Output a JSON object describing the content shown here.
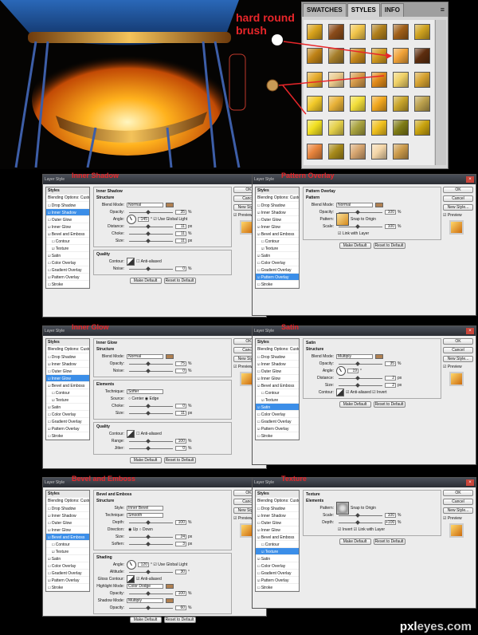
{
  "callout": {
    "line1": "hard round",
    "line2": "brush"
  },
  "panel": {
    "tabs": [
      "SWATCHES",
      "STYLES",
      "INFO"
    ],
    "active": "STYLES",
    "menu": "≡"
  },
  "swatch_colors": [
    "#d8a21c",
    "#8a4b1a",
    "#f0c44a",
    "#b07f1b",
    "#a05f18",
    "#cfa21f",
    "#c08316",
    "#a67e2a",
    "#c9891c",
    "#d39a1e",
    "#f0a238",
    "#5d2d0e",
    "#e6ac2c",
    "#e9c98c",
    "#d59a49",
    "#e18a19",
    "#efd066",
    "#d6a230",
    "#f2c928",
    "#e8b238",
    "#f2de3a",
    "#f1a71e",
    "#c9a52b",
    "#bca14d",
    "#f1df20",
    "#e4d04a",
    "#a8a23f",
    "#f0c01e",
    "#7f7c16",
    "#c9a30f",
    "#e8843c",
    "#a78a1a",
    "#d6a570",
    "#f4d6a8",
    "#cb9a4a"
  ],
  "watermark": {
    "a": "pxl",
    "b": "eyes.com"
  },
  "dialog_title": "Layer Style",
  "common": {
    "styles_header": "Styles",
    "blending": "Blending Options: Custom",
    "ok": "OK",
    "cancel": "Cancel",
    "new_style": "New Style...",
    "preview": "Preview",
    "make_default": "Make Default",
    "reset_default": "Reset to Default"
  },
  "layer_list": [
    "Drop Shadow",
    "Inner Shadow",
    "Outer Glow",
    "Inner Glow",
    "Bevel and Emboss",
    "Contour",
    "Texture",
    "Satin",
    "Color Overlay",
    "Gradient Overlay",
    "Pattern Overlay",
    "Stroke"
  ],
  "dialogs": [
    {
      "name": "Inner Shadow",
      "active": "Inner Shadow",
      "groups": [
        {
          "title": "Inner Shadow",
          "sub": "Structure",
          "rows": [
            [
              "Blend Mode:",
              "Normal",
              "",
              ""
            ],
            [
              "Opacity:",
              "",
              "35",
              "%"
            ],
            [
              "Angle:",
              "",
              "-145",
              "° ☑ Use Global Light"
            ],
            [
              "Distance:",
              "",
              "11",
              "px"
            ],
            [
              "Choke:",
              "",
              "11",
              "%"
            ],
            [
              "Size:",
              "",
              "11",
              "px"
            ]
          ]
        },
        {
          "title": "Quality",
          "rows": [
            [
              "Contour:",
              "",
              "",
              "☐ Anti-aliased"
            ],
            [
              "Noise:",
              "",
              "0",
              "%"
            ]
          ]
        }
      ]
    },
    {
      "name": "Pattern Overlay",
      "active": "Pattern Overlay",
      "groups": [
        {
          "title": "Pattern Overlay",
          "sub": "Pattern",
          "rows": [
            [
              "Blend Mode:",
              "Normal",
              "",
              ""
            ],
            [
              "Opacity:",
              "",
              "100",
              "%"
            ],
            [
              "Pattern:",
              "",
              "",
              "Snap to Origin"
            ],
            [
              "Scale:",
              "",
              "100",
              "%"
            ],
            [
              "",
              "",
              "",
              "☑ Link with Layer"
            ]
          ]
        }
      ]
    },
    {
      "name": "Inner Glow",
      "active": "Inner Glow",
      "groups": [
        {
          "title": "Inner Glow",
          "sub": "Structure",
          "rows": [
            [
              "Blend Mode:",
              "Normal",
              "",
              ""
            ],
            [
              "Opacity:",
              "",
              "75",
              "%"
            ],
            [
              "Noise:",
              "",
              "0",
              "%"
            ]
          ]
        },
        {
          "title": "Elements",
          "rows": [
            [
              "Technique:",
              "Softer",
              "",
              ""
            ],
            [
              "Source:",
              "",
              "",
              "○ Center ◉ Edge"
            ],
            [
              "Choke:",
              "",
              "0",
              "%"
            ],
            [
              "Size:",
              "",
              "11",
              "px"
            ]
          ]
        },
        {
          "title": "Quality",
          "rows": [
            [
              "Contour:",
              "",
              "",
              "☐ Anti-aliased"
            ],
            [
              "Range:",
              "",
              "100",
              "%"
            ],
            [
              "Jitter:",
              "",
              "0",
              "%"
            ]
          ]
        }
      ]
    },
    {
      "name": "Satin",
      "active": "Satin",
      "groups": [
        {
          "title": "Satin",
          "sub": "Structure",
          "rows": [
            [
              "Blend Mode:",
              "Multiply",
              "",
              ""
            ],
            [
              "Opacity:",
              "",
              "35",
              "%"
            ],
            [
              "Angle:",
              "",
              "19",
              "°"
            ],
            [
              "Distance:",
              "",
              "2",
              "px"
            ],
            [
              "Size:",
              "",
              "2",
              "px"
            ],
            [
              "Contour:",
              "",
              "",
              "☑ Anti-aliased ☑ Invert"
            ]
          ]
        }
      ]
    },
    {
      "name": "Bevel and Emboss",
      "active": "Bevel and Emboss",
      "groups": [
        {
          "title": "Bevel and Emboss",
          "sub": "Structure",
          "rows": [
            [
              "Style:",
              "Inner Bevel",
              "",
              ""
            ],
            [
              "Technique:",
              "Smooth",
              "",
              ""
            ],
            [
              "Depth:",
              "",
              "100",
              "%"
            ],
            [
              "Direction:",
              "",
              "",
              "◉ Up ○ Down"
            ],
            [
              "Size:",
              "",
              "24",
              "px"
            ],
            [
              "Soften:",
              "",
              "3",
              "px"
            ]
          ]
        },
        {
          "title": "Shading",
          "rows": [
            [
              "Angle:",
              "",
              "120",
              "° ☑ Use Global Light"
            ],
            [
              "Altitude:",
              "",
              "30",
              "°"
            ],
            [
              "Gloss Contour:",
              "",
              "",
              "☑ Anti-aliased"
            ],
            [
              "Highlight Mode:",
              "Color Dodge",
              "",
              ""
            ],
            [
              "Opacity:",
              "",
              "100",
              "%"
            ],
            [
              "Shadow Mode:",
              "Multiply",
              "",
              ""
            ],
            [
              "Opacity:",
              "",
              "60",
              "%"
            ]
          ]
        }
      ]
    },
    {
      "name": "Texture",
      "active": "Texture",
      "groups": [
        {
          "title": "Texture",
          "sub": "Elements",
          "rows": [
            [
              "Pattern:",
              "",
              "",
              "Snap to Origin"
            ],
            [
              "Scale:",
              "",
              "100",
              "%"
            ],
            [
              "Depth:",
              "",
              "+100",
              "%"
            ],
            [
              "",
              "",
              "",
              "☑ Invert ☑ Link with Layer"
            ]
          ]
        }
      ]
    }
  ]
}
